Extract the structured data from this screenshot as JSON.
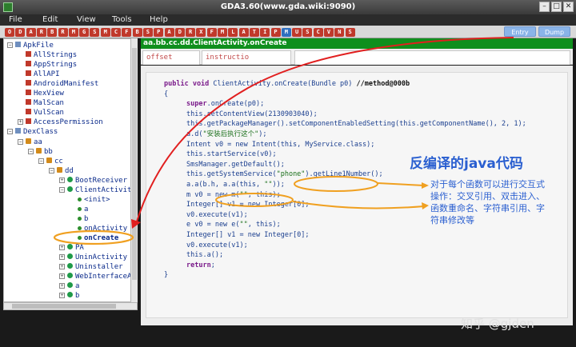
{
  "window": {
    "title": "GDA3.60(www.gda.wiki:9090)",
    "min_glyph": "–",
    "max_glyph": "□",
    "close_glyph": "✕"
  },
  "menu": [
    "File",
    "Edit",
    "View",
    "Tools",
    "Help"
  ],
  "toolbar": {
    "buttons": [
      {
        "glyph": "O",
        "color": "#c0392b"
      },
      {
        "glyph": "D",
        "color": "#c0392b"
      },
      {
        "glyph": "A",
        "color": "#c0392b"
      },
      {
        "glyph": "R",
        "color": "#c0392b"
      },
      {
        "glyph": "B",
        "color": "#c0392b"
      },
      {
        "glyph": "R",
        "color": "#c0392b"
      },
      {
        "glyph": "M",
        "color": "#c0392b"
      },
      {
        "glyph": "G",
        "color": "#c0392b"
      },
      {
        "glyph": "S",
        "color": "#c0392b"
      },
      {
        "glyph": "M",
        "color": "#c0392b"
      },
      {
        "glyph": "C",
        "color": "#c0392b"
      },
      {
        "glyph": "F",
        "color": "#c0392b"
      },
      {
        "glyph": "B",
        "color": "#c0392b"
      },
      {
        "glyph": "S",
        "color": "#c0392b"
      },
      {
        "glyph": "P",
        "color": "#c0392b"
      },
      {
        "glyph": "A",
        "color": "#c0392b"
      },
      {
        "glyph": "D",
        "color": "#c0392b"
      },
      {
        "glyph": "R",
        "color": "#c0392b"
      },
      {
        "glyph": "X",
        "color": "#c0392b"
      },
      {
        "glyph": "F",
        "color": "#c0392b"
      },
      {
        "glyph": "M",
        "color": "#c0392b"
      },
      {
        "glyph": "L",
        "color": "#c0392b"
      },
      {
        "glyph": "A",
        "color": "#c0392b"
      },
      {
        "glyph": "T",
        "color": "#c0392b"
      },
      {
        "glyph": "I",
        "color": "#c0392b"
      },
      {
        "glyph": "P",
        "color": "#c0392b"
      },
      {
        "glyph": "M",
        "color": "#2f6fbf"
      },
      {
        "glyph": "U",
        "color": "#c0392b"
      },
      {
        "glyph": "S",
        "color": "#c0392b"
      },
      {
        "glyph": "C",
        "color": "#c0392b"
      },
      {
        "glyph": "V",
        "color": "#c0392b"
      },
      {
        "glyph": "N",
        "color": "#c0392b"
      },
      {
        "glyph": "S",
        "color": "#c0392b"
      }
    ],
    "entry_label": "Entry",
    "dump_label": "Dump"
  },
  "tree": [
    {
      "indent": 0,
      "expander": "−",
      "icon": "folder",
      "label": "ApkFile"
    },
    {
      "indent": 1,
      "expander": "",
      "icon": "red",
      "label": "AllStrings"
    },
    {
      "indent": 1,
      "expander": "",
      "icon": "red",
      "label": "AppStrings"
    },
    {
      "indent": 1,
      "expander": "",
      "icon": "red",
      "label": "AllAPI"
    },
    {
      "indent": 1,
      "expander": "",
      "icon": "red",
      "label": "AndroidManifest"
    },
    {
      "indent": 1,
      "expander": "",
      "icon": "red",
      "label": "HexView"
    },
    {
      "indent": 1,
      "expander": "",
      "icon": "red",
      "label": "MalScan"
    },
    {
      "indent": 1,
      "expander": "",
      "icon": "red",
      "label": "VulScan"
    },
    {
      "indent": 1,
      "expander": "+",
      "icon": "red",
      "label": "AccessPermission"
    },
    {
      "indent": 0,
      "expander": "−",
      "icon": "folder",
      "label": "DexClass"
    },
    {
      "indent": 1,
      "expander": "−",
      "icon": "pkg",
      "label": "aa"
    },
    {
      "indent": 2,
      "expander": "−",
      "icon": "pkg",
      "label": "bb"
    },
    {
      "indent": 3,
      "expander": "−",
      "icon": "pkg",
      "label": "cc"
    },
    {
      "indent": 4,
      "expander": "−",
      "icon": "pkg",
      "label": "dd"
    },
    {
      "indent": 5,
      "expander": "+",
      "icon": "cls",
      "label": "BootReceiver"
    },
    {
      "indent": 5,
      "expander": "−",
      "icon": "cls",
      "label": "ClientActivit"
    },
    {
      "indent": 6,
      "expander": "",
      "icon": "mth",
      "label": "<init>"
    },
    {
      "indent": 6,
      "expander": "",
      "icon": "mth",
      "label": "a"
    },
    {
      "indent": 6,
      "expander": "",
      "icon": "mth",
      "label": "b"
    },
    {
      "indent": 6,
      "expander": "",
      "icon": "mth",
      "label": "onActivity"
    },
    {
      "indent": 6,
      "expander": "",
      "icon": "mth",
      "label": "onCreate",
      "selected": true
    },
    {
      "indent": 5,
      "expander": "+",
      "icon": "cls",
      "label": "PA"
    },
    {
      "indent": 5,
      "expander": "+",
      "icon": "cls",
      "label": "UninActivity"
    },
    {
      "indent": 5,
      "expander": "+",
      "icon": "cls",
      "label": "Uninstaller"
    },
    {
      "indent": 5,
      "expander": "+",
      "icon": "cls",
      "label": "WebInterfaceA"
    },
    {
      "indent": 5,
      "expander": "+",
      "icon": "cls",
      "label": "a"
    },
    {
      "indent": 5,
      "expander": "+",
      "icon": "cls",
      "label": "b"
    }
  ],
  "path": "aa.bb.cc.dd.ClientActivity.onCreate",
  "tabs": [
    {
      "label": "offset"
    },
    {
      "label": "instructio"
    },
    {
      "label": ""
    }
  ],
  "code": [
    {
      "kind": "head",
      "kw": "public void ",
      "text": "ClientActivity.onCreate(Bundle p0)",
      "comment": "//method@000b"
    },
    {
      "kind": "plain",
      "text": "{"
    },
    {
      "kind": "kwline",
      "kw": "super",
      "text": ".onCreate(p0);"
    },
    {
      "kind": "plain",
      "text": "this.setContentView(2130903040);"
    },
    {
      "kind": "plain",
      "text": "this.getPackageManager().setComponentEnabledSetting(this.getComponentName(), 2, 1);"
    },
    {
      "kind": "strline",
      "pre": "a.d(",
      "str": "\"安装后执行这个\"",
      "post": ");"
    },
    {
      "kind": "plain",
      "text": "Intent v0 = new Intent(this, MyService.class);"
    },
    {
      "kind": "plain",
      "text": "this.startService(v0);"
    },
    {
      "kind": "plain",
      "text": "SmsManager.getDefault();"
    },
    {
      "kind": "strline",
      "pre": "this.getSystemService(",
      "str": "\"phone\"",
      "post": ").getLine1Number();"
    },
    {
      "kind": "strline",
      "pre": "a.a(b.h, a.a(this, ",
      "str": "\"\"",
      "post": "));"
    },
    {
      "kind": "strline",
      "pre": "m v0 = new m(",
      "str": "\"\"",
      "post": ", this);"
    },
    {
      "kind": "plain",
      "text": "Integer[] v1 = new Integer[0];"
    },
    {
      "kind": "plain",
      "text": "v0.execute(v1);"
    },
    {
      "kind": "strline",
      "pre": "e v0 = new e(",
      "str": "\"\"",
      "post": ", this);"
    },
    {
      "kind": "plain",
      "text": "Integer[] v1 = new Integer[0];"
    },
    {
      "kind": "plain",
      "text": "v0.execute(v1);"
    },
    {
      "kind": "plain",
      "text": "this.a();"
    },
    {
      "kind": "kwline",
      "kw": "return",
      "text": ";"
    },
    {
      "kind": "plain",
      "text": "}"
    }
  ],
  "annotations": {
    "heading": "反编译的java代码",
    "note_lines": [
      "对于每个函数可以进行交互式",
      "操作：交叉引用、双击进入、",
      "函数重命名、字符串引用、字",
      "符串修改等"
    ],
    "watermark": "知乎 @gjden",
    "arrow_color": "#e11f1f",
    "highlight_color": "#f0a020"
  }
}
